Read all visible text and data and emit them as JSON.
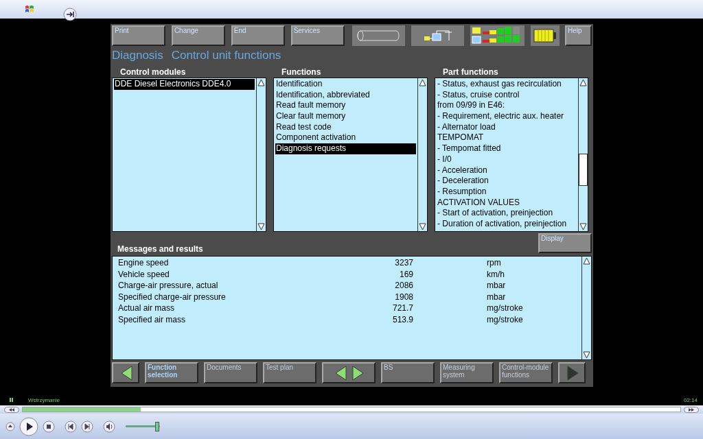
{
  "toolbar": {
    "buttons": [
      "Print",
      "Change",
      "End",
      "Services"
    ],
    "help": "Help"
  },
  "title": {
    "section": "Diagnosis",
    "page": "Control unit functions"
  },
  "control_modules": {
    "heading": "Control modules",
    "items": [
      {
        "text": "DDE Diesel Electronics DDE4.0",
        "selected": true
      }
    ]
  },
  "functions": {
    "heading": "Functions",
    "items": [
      {
        "text": "Identification",
        "selected": false
      },
      {
        "text": "Identification, abbreviated",
        "selected": false
      },
      {
        "text": "Read fault memory",
        "selected": false
      },
      {
        "text": "Clear fault memory",
        "selected": false
      },
      {
        "text": "Read test code",
        "selected": false
      },
      {
        "text": "Component activation",
        "selected": false
      },
      {
        "text": "Diagnosis requests",
        "selected": true
      }
    ]
  },
  "part_functions": {
    "heading": "Part functions",
    "items": [
      "- Status, exhaust gas recirculation",
      "- Status, cruise control",
      "from 09/99 in E46:",
      "- Requirement, electric aux. heater",
      "- Alternator load",
      "TEMPOMAT",
      "- Tempomat fitted",
      "- I/0",
      "- Acceleration",
      "- Deceleration",
      "- Resumption",
      "ACTIVATION VALUES",
      "- Start of activation, preinjection",
      "- Duration of activation, preinjection"
    ]
  },
  "display_button": "Display",
  "results": {
    "heading": "Messages and results",
    "rows": [
      {
        "name": "Engine speed",
        "value": "3237",
        "unit": "rpm"
      },
      {
        "name": "Vehicle speed",
        "value": "169",
        "unit": "km/h"
      },
      {
        "name": "Charge-air pressure, actual",
        "value": "2086",
        "unit": "mbar"
      },
      {
        "name": "Specified charge-air pressure",
        "value": "1908",
        "unit": "mbar"
      },
      {
        "name": "Actual air mass",
        "value": "721.7",
        "unit": "mg/stroke"
      },
      {
        "name": "Specified air mass",
        "value": "513.9",
        "unit": "mg/stroke"
      }
    ]
  },
  "nav": [
    {
      "kind": "arrow-left",
      "disabled": false
    },
    {
      "kind": "text",
      "label": "Function selection",
      "disabled": false
    },
    {
      "kind": "text",
      "label": "Documents",
      "disabled": true
    },
    {
      "kind": "text",
      "label": "Test plan",
      "disabled": true
    },
    {
      "kind": "arrow-pair",
      "disabled": false
    },
    {
      "kind": "text",
      "label": "BS",
      "disabled": true
    },
    {
      "kind": "text",
      "label": "Measuring system",
      "disabled": true
    },
    {
      "kind": "text",
      "label": "Control-module functions",
      "disabled": true
    },
    {
      "kind": "arrow-right",
      "disabled": true
    }
  ],
  "player": {
    "status": "Wstrzymanie",
    "time": "02:14",
    "seek": {
      "level": 0.18
    },
    "volume": {
      "level": 0.92
    }
  }
}
